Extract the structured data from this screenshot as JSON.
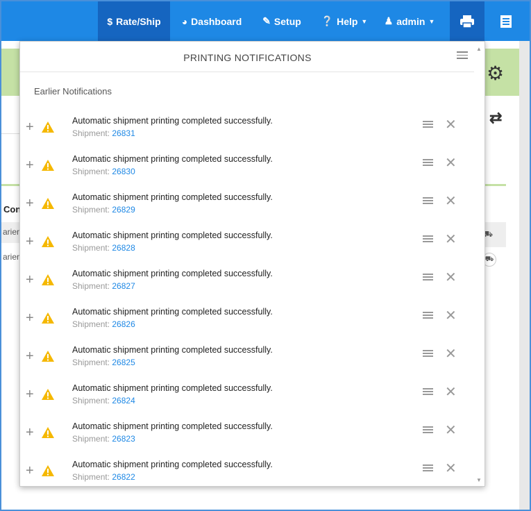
{
  "nav": {
    "rateship": "Rate/Ship",
    "dashboard": "Dashboard",
    "setup": "Setup",
    "help": "Help",
    "admin": "admin"
  },
  "background": {
    "con_label": "Con",
    "row1_text": "arien",
    "row2_text": "arien"
  },
  "panel": {
    "title": "PRINTING NOTIFICATIONS",
    "section_label": "Earlier Notifications",
    "shipment_prefix": "Shipment:",
    "notifications": [
      {
        "message": "Automatic shipment printing completed successfully.",
        "shipment": "26831"
      },
      {
        "message": "Automatic shipment printing completed successfully.",
        "shipment": "26830"
      },
      {
        "message": "Automatic shipment printing completed successfully.",
        "shipment": "26829"
      },
      {
        "message": "Automatic shipment printing completed successfully.",
        "shipment": "26828"
      },
      {
        "message": "Automatic shipment printing completed successfully.",
        "shipment": "26827"
      },
      {
        "message": "Automatic shipment printing completed successfully.",
        "shipment": "26826"
      },
      {
        "message": "Automatic shipment printing completed successfully.",
        "shipment": "26825"
      },
      {
        "message": "Automatic shipment printing completed successfully.",
        "shipment": "26824"
      },
      {
        "message": "Automatic shipment printing completed successfully.",
        "shipment": "26823"
      },
      {
        "message": "Automatic shipment printing completed successfully.",
        "shipment": "26822"
      }
    ]
  },
  "colors": {
    "nav_bg": "#1e88e5",
    "nav_active": "#1565c0",
    "accent_green": "#c5e1a5",
    "link_blue": "#1e88e5",
    "warning_yellow": "#f5b800"
  }
}
